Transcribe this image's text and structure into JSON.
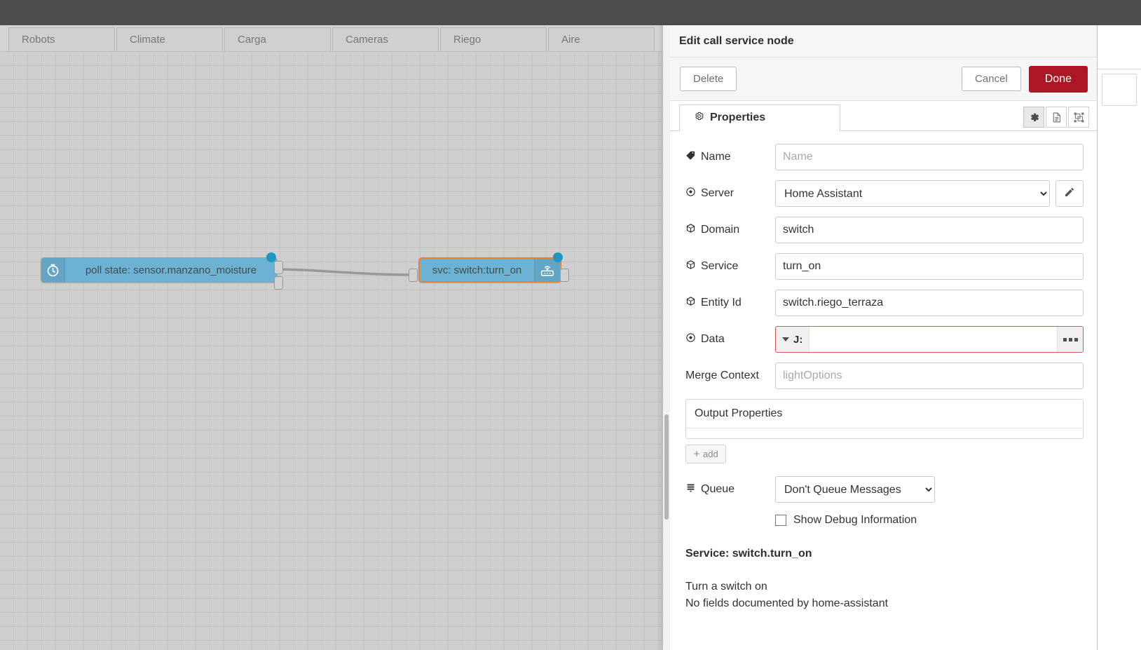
{
  "workspace": {
    "tabs": [
      {
        "label": "Robots"
      },
      {
        "label": "Climate"
      },
      {
        "label": "Carga"
      },
      {
        "label": "Cameras"
      },
      {
        "label": "Riego"
      },
      {
        "label": "Aire"
      }
    ],
    "nodes": [
      {
        "id": "poll-state-node",
        "label": "poll state: sensor.manzano_moisture",
        "icon": "stopwatch-icon",
        "selected": false
      },
      {
        "id": "call-service-node",
        "label": "svc: switch:turn_on",
        "icon": "home-assistant-router-icon",
        "selected": true
      }
    ]
  },
  "dialog": {
    "title": "Edit call service node",
    "buttons": {
      "delete": "Delete",
      "cancel": "Cancel",
      "done": "Done"
    },
    "tabs": [
      {
        "label": "Properties",
        "icon": "gear-icon",
        "active": true
      }
    ],
    "icon_buttons": [
      {
        "name": "gear-icon",
        "active": true
      },
      {
        "name": "description-document-icon",
        "active": false
      },
      {
        "name": "appearance-node-icon",
        "active": false
      }
    ],
    "fields": {
      "name": {
        "label": "Name",
        "value": "",
        "placeholder": "Name",
        "icon": "tag-icon"
      },
      "server": {
        "label": "Server",
        "value": "Home Assistant",
        "icon": "target-icon",
        "options": [
          "Home Assistant"
        ]
      },
      "domain": {
        "label": "Domain",
        "value": "switch",
        "placeholder": "",
        "icon": "cube-icon"
      },
      "service": {
        "label": "Service",
        "value": "turn_on",
        "placeholder": "",
        "icon": "cube-icon"
      },
      "entity_id": {
        "label": "Entity Id",
        "value": "switch.riego_terraza",
        "placeholder": "",
        "icon": "cube-icon"
      },
      "data": {
        "label": "Data",
        "type_label": "J:",
        "value": "",
        "placeholder": "",
        "icon": "target-icon",
        "error": true,
        "error_color": "#d55a52"
      },
      "merge_context": {
        "label": "Merge Context",
        "value": "",
        "placeholder": "lightOptions"
      },
      "queue": {
        "label": "Queue",
        "value": "Don't Queue Messages",
        "icon": "stack-icon",
        "options": [
          "Don't Queue Messages"
        ]
      },
      "show_debug": {
        "label": "Show Debug Information",
        "checked": false
      }
    },
    "output_properties": {
      "header": "Output Properties",
      "add_label": "add",
      "rows": []
    },
    "service_info": {
      "title": "Service: switch.turn_on",
      "line1": "Turn a switch on",
      "line2": "No fields documented by home-assistant"
    }
  },
  "colors": {
    "accent_red": "#ad1625",
    "node_blue": "#6bb2d4",
    "selection_orange": "#e8842b",
    "error_red": "#d55a52",
    "canvas_grey": "#cfcfcf"
  }
}
